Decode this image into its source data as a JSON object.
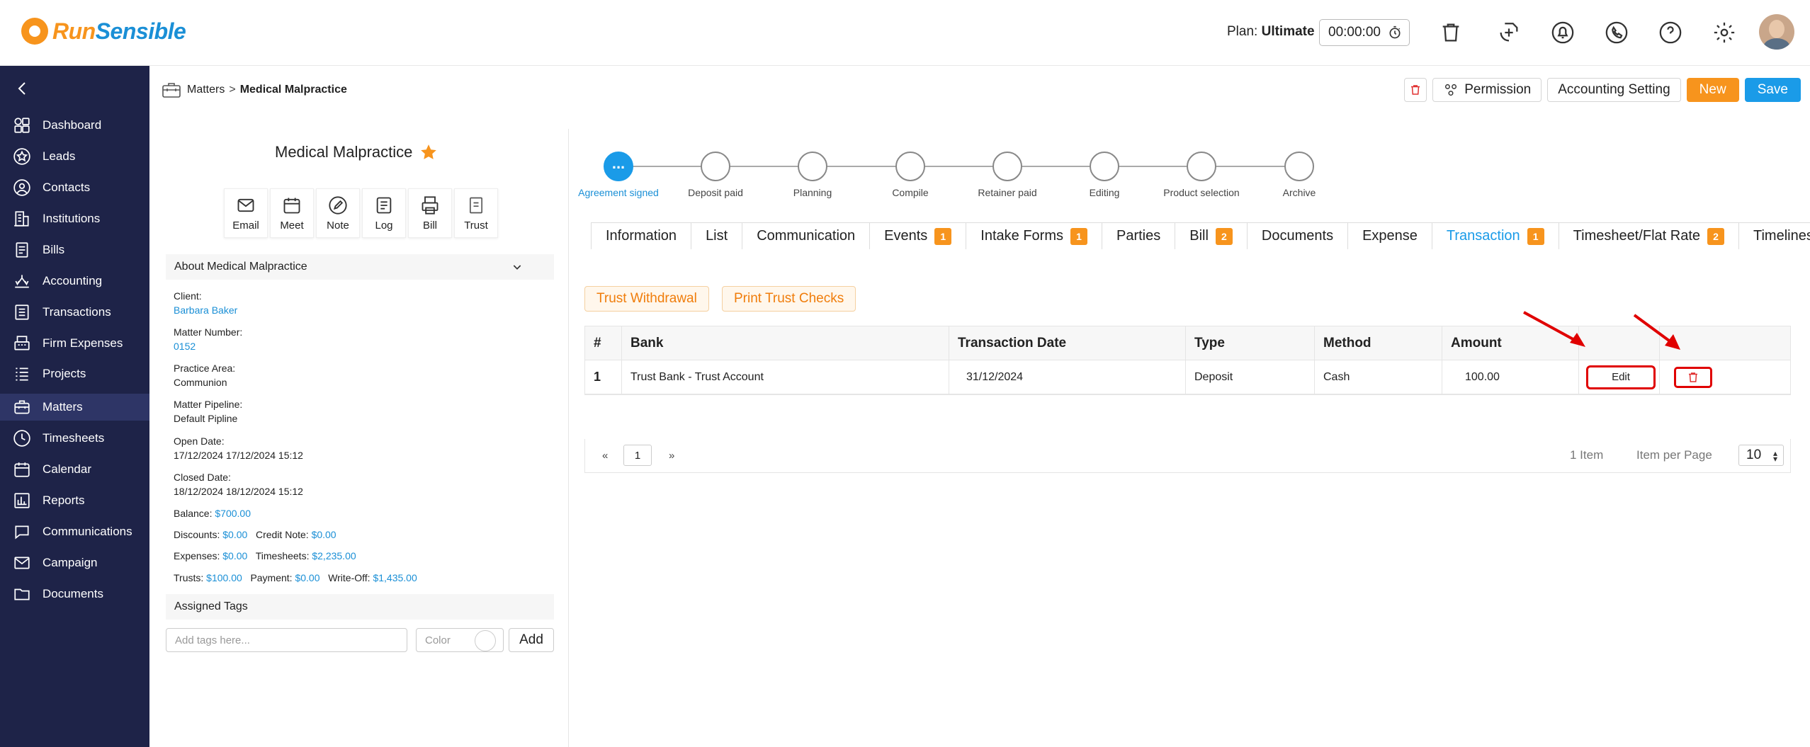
{
  "header": {
    "logo_run": "Run",
    "logo_sensible": "Sensible",
    "plan_label": "Plan:",
    "plan_value": "Ultimate",
    "timer": "00:00:00"
  },
  "sidebar": {
    "items": [
      {
        "label": "Dashboard",
        "icon": "dashboard-icon"
      },
      {
        "label": "Leads",
        "icon": "star-icon"
      },
      {
        "label": "Contacts",
        "icon": "user-icon"
      },
      {
        "label": "Institutions",
        "icon": "building-icon"
      },
      {
        "label": "Bills",
        "icon": "receipt-icon"
      },
      {
        "label": "Accounting",
        "icon": "scale-icon"
      },
      {
        "label": "Transactions",
        "icon": "transactions-icon"
      },
      {
        "label": "Firm Expenses",
        "icon": "register-icon"
      },
      {
        "label": "Projects",
        "icon": "list-icon"
      },
      {
        "label": "Matters",
        "icon": "briefcase-icon"
      },
      {
        "label": "Timesheets",
        "icon": "clock-icon"
      },
      {
        "label": "Calendar",
        "icon": "calendar-icon"
      },
      {
        "label": "Reports",
        "icon": "report-icon"
      },
      {
        "label": "Communications",
        "icon": "chat-icon"
      },
      {
        "label": "Campaign",
        "icon": "mail-icon"
      },
      {
        "label": "Documents",
        "icon": "folder-icon"
      }
    ],
    "active": "Matters"
  },
  "breadcrumb": {
    "parent": "Matters",
    "sep": ">",
    "current": "Medical Malpractice"
  },
  "actions": {
    "permission": "Permission",
    "accounting_setting": "Accounting Setting",
    "new": "New",
    "save": "Save"
  },
  "matter": {
    "title": "Medical Malpractice",
    "quick_actions": [
      "Email",
      "Meet",
      "Note",
      "Log",
      "Bill",
      "Trust"
    ],
    "about_title": "About Medical Malpractice",
    "client_label": "Client:",
    "client_value": "Barbara Baker",
    "number_label": "Matter Number:",
    "number_value": "0152",
    "practice_label": "Practice Area:",
    "practice_value": "Communion",
    "pipeline_label": "Matter Pipeline:",
    "pipeline_value": "Default Pipline",
    "open_label": "Open Date:",
    "open_value": "17/12/2024 17/12/2024 15:12",
    "closed_label": "Closed Date:",
    "closed_value": "18/12/2024 18/12/2024 15:12",
    "balance_label": "Balance:",
    "balance_value": "$700.00",
    "discounts_label": "Discounts:",
    "discounts_value": "$0.00",
    "credit_label": "Credit Note:",
    "credit_value": "$0.00",
    "expenses_label": "Expenses:",
    "expenses_value": "$0.00",
    "timesheets_label": "Timesheets:",
    "timesheets_value": "$2,235.00",
    "trusts_label": "Trusts:",
    "trusts_value": "$100.00",
    "payment_label": "Payment:",
    "payment_value": "$0.00",
    "writeoff_label": "Write-Off:",
    "writeoff_value": "$1,435.00",
    "tags_title": "Assigned Tags",
    "tags_placeholder": "Add tags here...",
    "color_label": "Color",
    "add_label": "Add"
  },
  "pipeline": {
    "active_dot": "...",
    "stages": [
      "Agreement signed",
      "Deposit paid",
      "Planning",
      "Compile",
      "Retainer paid",
      "Editing",
      "Product selection",
      "Archive"
    ]
  },
  "tabs": [
    {
      "label": "Information",
      "badge": ""
    },
    {
      "label": "List",
      "badge": ""
    },
    {
      "label": "Communication",
      "badge": ""
    },
    {
      "label": "Events",
      "badge": "1"
    },
    {
      "label": "Intake Forms",
      "badge": "1"
    },
    {
      "label": "Parties",
      "badge": ""
    },
    {
      "label": "Bill",
      "badge": "2"
    },
    {
      "label": "Documents",
      "badge": ""
    },
    {
      "label": "Expense",
      "badge": ""
    },
    {
      "label": "Transaction",
      "badge": "1"
    },
    {
      "label": "Timesheet/Flat Rate",
      "badge": "2"
    },
    {
      "label": "Timelines",
      "badge": ""
    }
  ],
  "transaction": {
    "trust_withdrawal": "Trust Withdrawal",
    "print_checks": "Print Trust Checks",
    "columns": [
      "#",
      "Bank",
      "Transaction Date",
      "Type",
      "Method",
      "Amount"
    ],
    "rows": [
      {
        "num": "1",
        "bank": "Trust Bank - Trust Account",
        "date": "31/12/2024",
        "type": "Deposit",
        "method": "Cash",
        "amount": "100.00",
        "edit": "Edit"
      }
    ],
    "pager_prev": "«",
    "pager_page": "1",
    "pager_next": "»",
    "item_count": "1 Item",
    "per_page_label": "Item per Page",
    "per_page_value": "10"
  },
  "colors": {
    "sidebar_bg": "#1e2348",
    "accent_blue": "#1a9be8",
    "accent_orange": "#f7941d",
    "annotation_red": "#e00000"
  }
}
